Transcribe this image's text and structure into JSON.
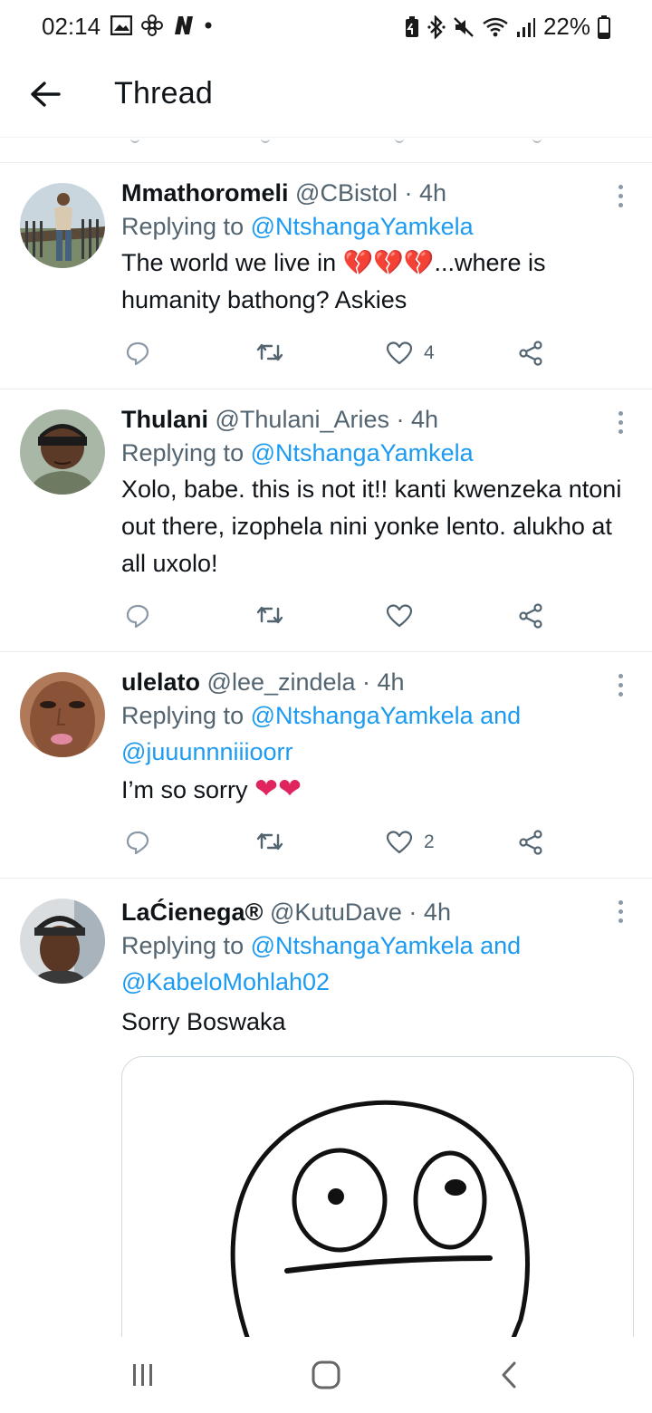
{
  "status_bar": {
    "time": "02:14",
    "battery_percent": "22%",
    "left_icons": [
      "gallery-icon",
      "fan-icon",
      "n-app-icon",
      "dot-icon"
    ],
    "right_icons": [
      "battery-saver-icon",
      "bluetooth-icon",
      "mute-icon",
      "wifi-icon",
      "signal-icon",
      "battery-icon"
    ]
  },
  "header": {
    "title": "Thread",
    "back_icon": "arrow-left-icon"
  },
  "tweets": [
    {
      "name": "Mmathoromeli",
      "handle": "@CBistol · 4h",
      "replying_prefix": "Replying to ",
      "mentions": "@NtshangaYamkela",
      "text_before": "The world we live in ",
      "emojis": "💔💔💔",
      "text_after": "...where is humanity bathong? Askies",
      "likes": "4"
    },
    {
      "name": "Thulani",
      "handle": "@Thulani_Aries · 4h",
      "replying_prefix": "Replying to ",
      "mentions": "@NtshangaYamkela",
      "text": "Xolo, babe. this is not it!! kanti kwenzeka ntoni out there, izophela nini yonke lento. alukho at all uxolo!",
      "likes": ""
    },
    {
      "name": "ulelato",
      "handle": "@lee_zindela · 4h",
      "replying_prefix": "Replying to ",
      "mentions": "@NtshangaYamkela and @juuunnniiioorr",
      "text": "I’m so sorry ",
      "emojis": "❤❤",
      "likes": "2"
    },
    {
      "name": "LaĆienega®",
      "handle": "@KutuDave · 4h",
      "replying_prefix": "Replying to ",
      "mentions": "@NtshangaYamkela and @KabeloMohlah02",
      "text": "Sorry Boswaka",
      "likes": ""
    }
  ],
  "colors": {
    "link": "#1d9bf0",
    "secondary_text": "#536471",
    "primary_text": "#0f1419",
    "heart": "#e0245e"
  }
}
